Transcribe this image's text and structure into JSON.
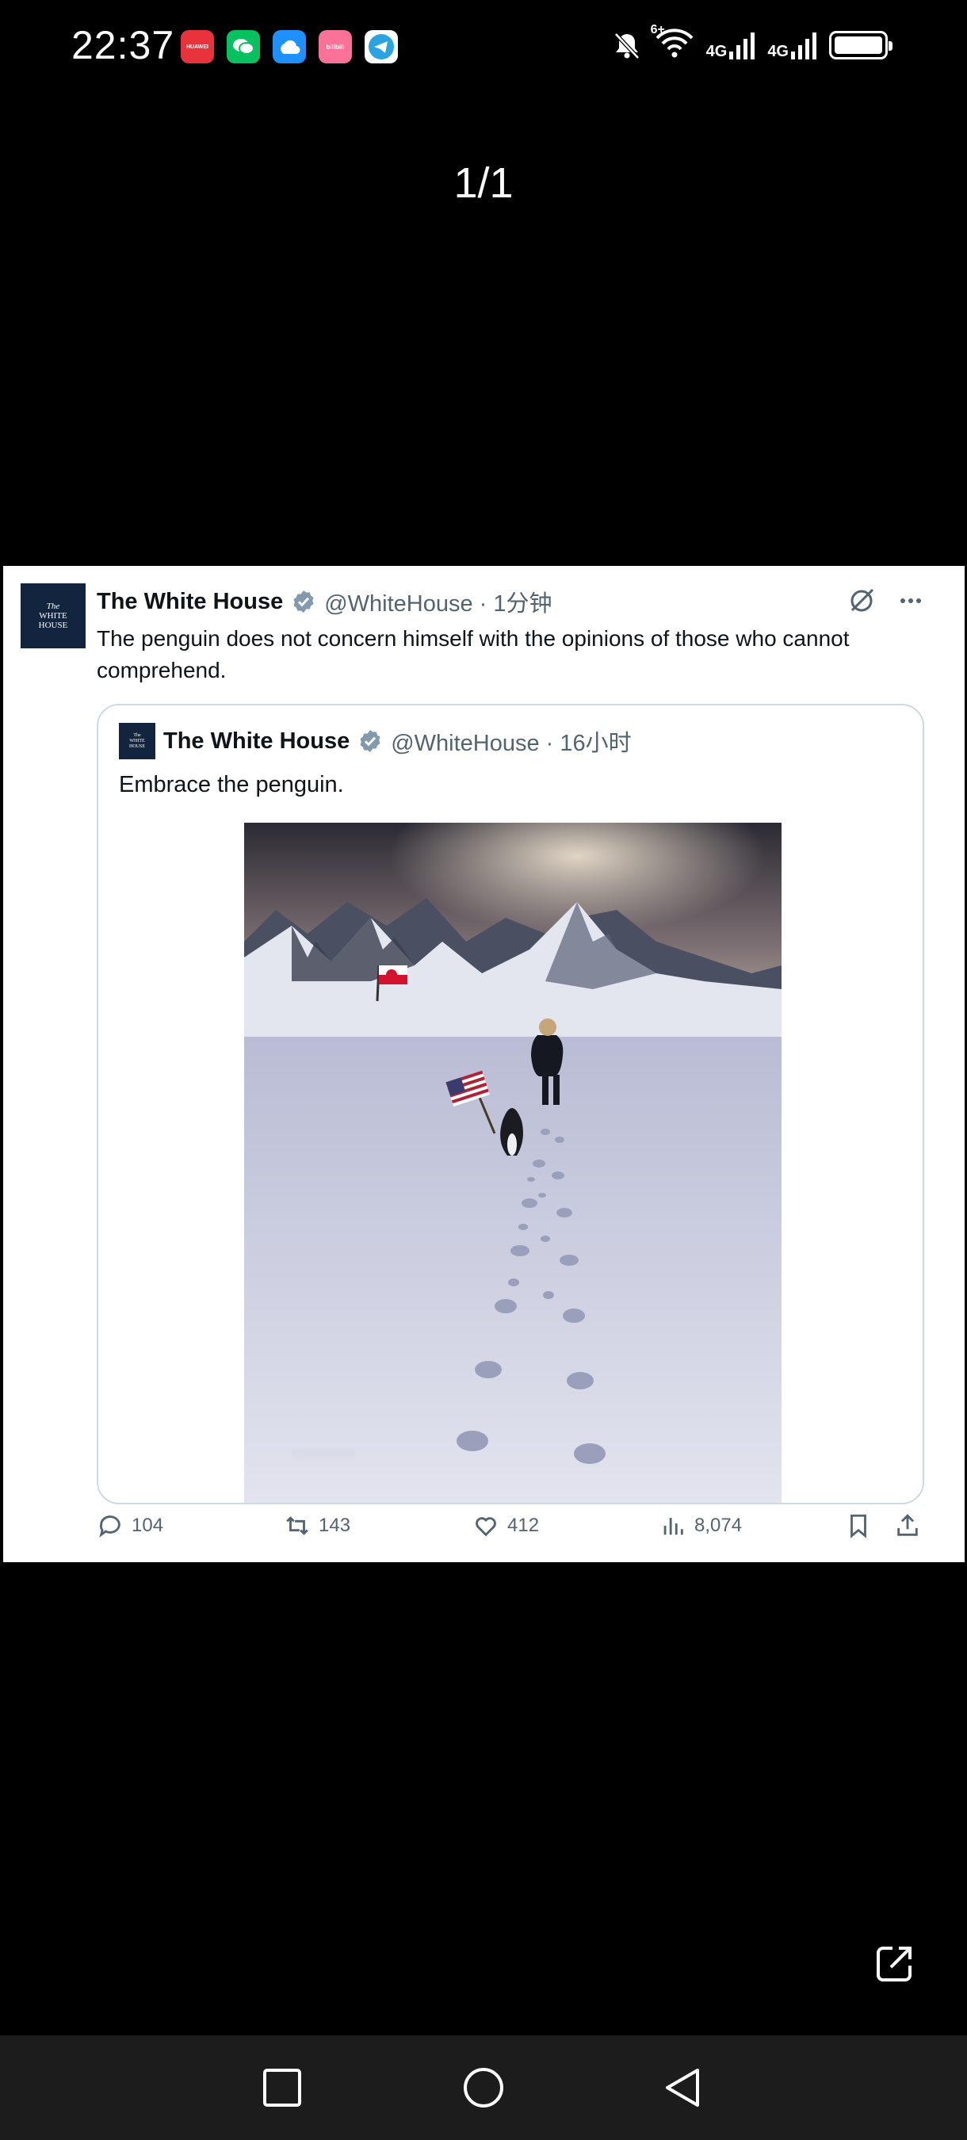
{
  "status_bar": {
    "time": "22:37",
    "app_icons": [
      "huawei-store-icon",
      "wechat-icon",
      "cloud-icon",
      "tv-app-icon",
      "telegram-icon"
    ],
    "huawei_label": "HUAWEI",
    "tv_label": "bilibili",
    "network_1": "4G",
    "network_2": "4G",
    "wifi_badge": "6+"
  },
  "viewer": {
    "counter": "1/1"
  },
  "tweet": {
    "author_name": "The White House",
    "handle_time": "@WhiteHouse · 1分钟",
    "text": "The penguin does not concern himself with the opinions of those who cannot comprehend.",
    "avatar_lines": [
      "The",
      "WHITE",
      "HOUSE"
    ],
    "quote": {
      "author_name": "The White House",
      "handle_time": "@WhiteHouse · 16小时",
      "text": "Embrace the penguin.",
      "image_alt": "man and penguin walking across snow toward mountains with a flag"
    },
    "stats": {
      "replies": "104",
      "retweets": "143",
      "likes": "412",
      "views": "8,074"
    }
  },
  "colors": {
    "brand_blue": "#1d9bf0",
    "verified_gray": "#829aab",
    "text_gray": "#536471",
    "avatar_navy": "#13243f"
  }
}
